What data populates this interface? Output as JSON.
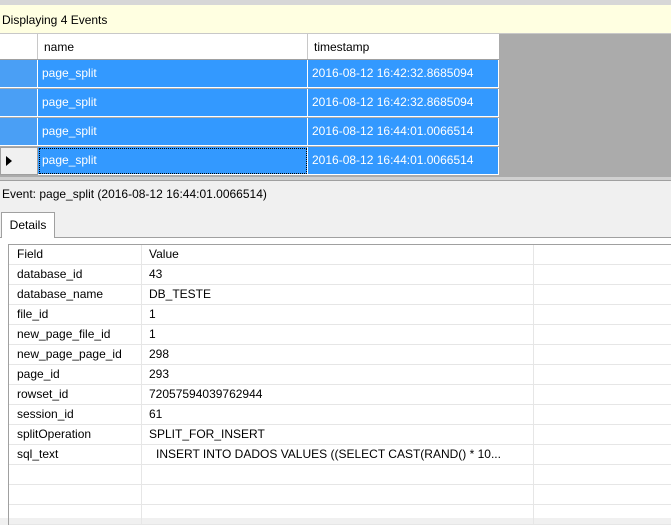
{
  "status": {
    "text": "Displaying 4 Events"
  },
  "grid": {
    "columns": [
      "name",
      "timestamp"
    ],
    "rows": [
      {
        "name": "page_split",
        "timestamp": "2016-08-12 16:42:32.8685094"
      },
      {
        "name": "page_split",
        "timestamp": "2016-08-12 16:42:32.8685094"
      },
      {
        "name": "page_split",
        "timestamp": "2016-08-12 16:44:01.0066514"
      },
      {
        "name": "page_split",
        "timestamp": "2016-08-12 16:44:01.0066514"
      }
    ]
  },
  "event_title": "Event: page_split (2016-08-12 16:44:01.0066514)",
  "tabs": {
    "details": "Details"
  },
  "details": {
    "headers": {
      "field": "Field",
      "value": "Value"
    },
    "rows": [
      {
        "field": "database_id",
        "value": "43"
      },
      {
        "field": "database_name",
        "value": "DB_TESTE"
      },
      {
        "field": "file_id",
        "value": "1"
      },
      {
        "field": "new_page_file_id",
        "value": "1"
      },
      {
        "field": "new_page_page_id",
        "value": "298"
      },
      {
        "field": "page_id",
        "value": "293"
      },
      {
        "field": "rowset_id",
        "value": "72057594039762944"
      },
      {
        "field": "session_id",
        "value": "61"
      },
      {
        "field": "splitOperation",
        "value": "SPLIT_FOR_INSERT"
      },
      {
        "field": "sql_text",
        "value": "INSERT INTO DADOS VALUES ((SELECT CAST(RAND() * 10..."
      }
    ]
  },
  "colors": {
    "selection": "#3399ff",
    "status_bg": "#ffffe1"
  }
}
